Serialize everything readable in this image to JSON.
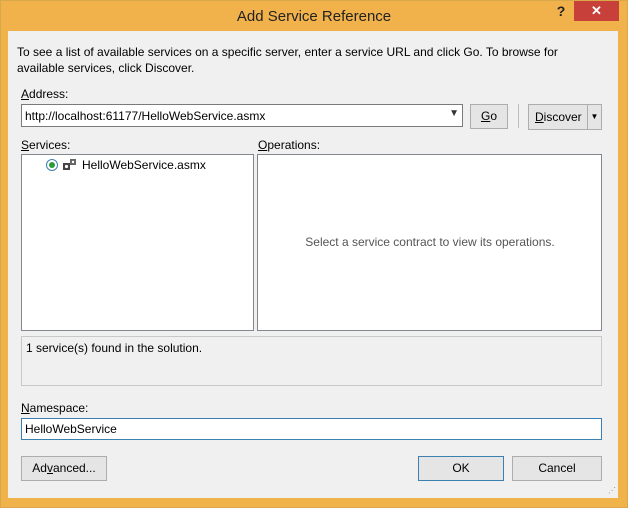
{
  "window": {
    "title": "Add Service Reference",
    "help_glyph": "?",
    "close_glyph": "✕"
  },
  "description": "To see a list of available services on a specific server, enter a service URL and click Go. To browse for available services, click Discover.",
  "address": {
    "label_accel": "A",
    "label_rest": "ddress:",
    "value": "http://localhost:61177/HelloWebService.asmx"
  },
  "buttons": {
    "go_accel": "G",
    "go_rest": "o",
    "discover_accel": "D",
    "discover_rest": "iscover",
    "advanced_pre": "Ad",
    "advanced_accel": "v",
    "advanced_post": "anced...",
    "ok": "OK",
    "cancel": "Cancel"
  },
  "services": {
    "label_accel": "S",
    "label_rest": "ervices:",
    "items": [
      {
        "label": "HelloWebService.asmx",
        "icon": "service-icon"
      }
    ]
  },
  "operations": {
    "label_accel": "O",
    "label_rest": "perations:",
    "placeholder": "Select a service contract to view its operations."
  },
  "status": "1 service(s) found in the solution.",
  "namespace": {
    "label_accel": "N",
    "label_rest": "amespace:",
    "value": "HelloWebService"
  },
  "colors": {
    "titlebar": "#f2b24b",
    "close": "#c7403a",
    "focus_border": "#3c7fb1"
  }
}
